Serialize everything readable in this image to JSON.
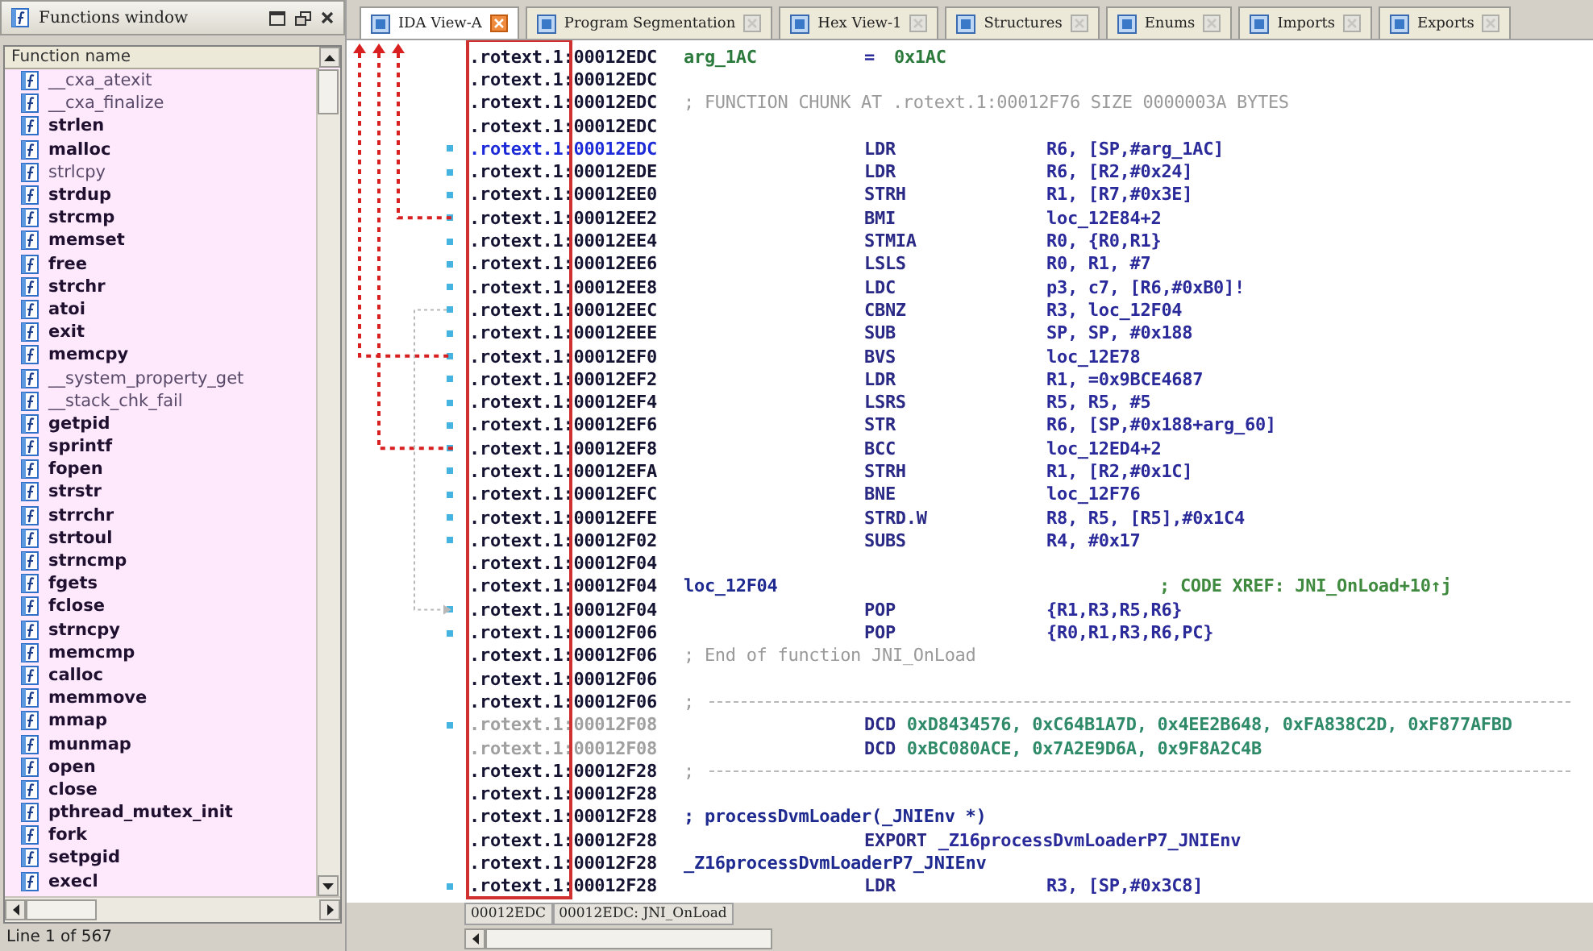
{
  "functions_window": {
    "title": "Functions window",
    "column": "Function name",
    "footer": "Line 1 of 567",
    "items": [
      {
        "name": "__cxa_atexit",
        "library": true
      },
      {
        "name": "__cxa_finalize",
        "library": true
      },
      {
        "name": "strlen",
        "library": false
      },
      {
        "name": "malloc",
        "library": false
      },
      {
        "name": "strlcpy",
        "library": true
      },
      {
        "name": "strdup",
        "library": false
      },
      {
        "name": "strcmp",
        "library": false
      },
      {
        "name": "memset",
        "library": false
      },
      {
        "name": "free",
        "library": false
      },
      {
        "name": "strchr",
        "library": false
      },
      {
        "name": "atoi",
        "library": false
      },
      {
        "name": "exit",
        "library": false
      },
      {
        "name": "memcpy",
        "library": false
      },
      {
        "name": "__system_property_get",
        "library": true
      },
      {
        "name": "__stack_chk_fail",
        "library": true
      },
      {
        "name": "getpid",
        "library": false
      },
      {
        "name": "sprintf",
        "library": false
      },
      {
        "name": "fopen",
        "library": false
      },
      {
        "name": "strstr",
        "library": false
      },
      {
        "name": "strrchr",
        "library": false
      },
      {
        "name": "strtoul",
        "library": false
      },
      {
        "name": "strncmp",
        "library": false
      },
      {
        "name": "fgets",
        "library": false
      },
      {
        "name": "fclose",
        "library": false
      },
      {
        "name": "strncpy",
        "library": false
      },
      {
        "name": "memcmp",
        "library": false
      },
      {
        "name": "calloc",
        "library": false
      },
      {
        "name": "memmove",
        "library": false
      },
      {
        "name": "mmap",
        "library": false
      },
      {
        "name": "munmap",
        "library": false
      },
      {
        "name": "open",
        "library": false
      },
      {
        "name": "close",
        "library": false
      },
      {
        "name": "pthread_mutex_init",
        "library": false
      },
      {
        "name": "fork",
        "library": false
      },
      {
        "name": "setpgid",
        "library": false
      },
      {
        "name": "execl",
        "library": false
      }
    ]
  },
  "tabs": [
    {
      "label": "IDA View-A",
      "selected": true
    },
    {
      "label": "Program Segmentation",
      "selected": false
    },
    {
      "label": "Hex View-1",
      "selected": false
    },
    {
      "label": "Structures",
      "selected": false
    },
    {
      "label": "Enums",
      "selected": false
    },
    {
      "label": "Imports",
      "selected": false
    },
    {
      "label": "Exports",
      "selected": false
    }
  ],
  "lines": [
    {
      "kind": "stackvar",
      "address": ".rotext.1:00012EDC",
      "name": "arg_1AC",
      "assign": "=",
      "value": "0x1AC",
      "dot": false,
      "selected": false
    },
    {
      "kind": "blank",
      "address": ".rotext.1:00012EDC",
      "dot": false,
      "selected": false
    },
    {
      "kind": "comment",
      "address": ".rotext.1:00012EDC",
      "text": "; FUNCTION CHUNK AT .rotext.1:00012F76 SIZE 0000003A BYTES",
      "dot": false,
      "selected": false
    },
    {
      "kind": "blank",
      "address": ".rotext.1:00012EDC",
      "dot": false,
      "selected": false
    },
    {
      "kind": "instr",
      "address": ".rotext.1:00012EDC",
      "mnemonic": "LDR",
      "operands": "R6, [SP,#arg_1AC]",
      "dot": true,
      "selected": true
    },
    {
      "kind": "instr",
      "address": ".rotext.1:00012EDE",
      "mnemonic": "LDR",
      "operands": "R6, [R2,#0x24]",
      "dot": true,
      "selected": false
    },
    {
      "kind": "instr",
      "address": ".rotext.1:00012EE0",
      "mnemonic": "STRH",
      "operands": "R1, [R7,#0x3E]",
      "dot": true,
      "selected": false
    },
    {
      "kind": "instr",
      "address": ".rotext.1:00012EE2",
      "mnemonic": "BMI",
      "operands": "loc_12E84+2",
      "dot": true,
      "selected": false
    },
    {
      "kind": "instr",
      "address": ".rotext.1:00012EE4",
      "mnemonic": "STMIA",
      "operands": "R0, {R0,R1}",
      "dot": true,
      "selected": false
    },
    {
      "kind": "instr",
      "address": ".rotext.1:00012EE6",
      "mnemonic": "LSLS",
      "operands": "R0, R1, #7",
      "dot": true,
      "selected": false
    },
    {
      "kind": "instr",
      "address": ".rotext.1:00012EE8",
      "mnemonic": "LDC",
      "operands": "p3, c7, [R6,#0xB0]!",
      "dot": true,
      "selected": false
    },
    {
      "kind": "instr",
      "address": ".rotext.1:00012EEC",
      "mnemonic": "CBNZ",
      "operands": "R3, loc_12F04",
      "dot": true,
      "selected": false
    },
    {
      "kind": "instr",
      "address": ".rotext.1:00012EEE",
      "mnemonic": "SUB",
      "operands": "SP, SP, #0x188",
      "dot": true,
      "selected": false
    },
    {
      "kind": "instr",
      "address": ".rotext.1:00012EF0",
      "mnemonic": "BVS",
      "operands": "loc_12E78",
      "dot": true,
      "selected": false
    },
    {
      "kind": "instr",
      "address": ".rotext.1:00012EF2",
      "mnemonic": "LDR",
      "operands": "R1, =0x9BCE4687",
      "dot": true,
      "selected": false
    },
    {
      "kind": "instr",
      "address": ".rotext.1:00012EF4",
      "mnemonic": "LSRS",
      "operands": "R5, R5, #5",
      "dot": true,
      "selected": false
    },
    {
      "kind": "instr",
      "address": ".rotext.1:00012EF6",
      "mnemonic": "STR",
      "operands": "R6, [SP,#0x188+arg_60]",
      "dot": true,
      "selected": false
    },
    {
      "kind": "instr",
      "address": ".rotext.1:00012EF8",
      "mnemonic": "BCC",
      "operands": "loc_12ED4+2",
      "dot": true,
      "selected": false
    },
    {
      "kind": "instr",
      "address": ".rotext.1:00012EFA",
      "mnemonic": "STRH",
      "operands": "R1, [R2,#0x1C]",
      "dot": true,
      "selected": false
    },
    {
      "kind": "instr",
      "address": ".rotext.1:00012EFC",
      "mnemonic": "BNE",
      "operands": "loc_12F76",
      "dot": true,
      "selected": false
    },
    {
      "kind": "instr",
      "address": ".rotext.1:00012EFE",
      "mnemonic": "STRD.W",
      "operands": "R8, R5, [R5],#0x1C4",
      "dot": true,
      "selected": false
    },
    {
      "kind": "instr",
      "address": ".rotext.1:00012F02",
      "mnemonic": "SUBS",
      "operands": "R4, #0x17",
      "dot": true,
      "selected": false
    },
    {
      "kind": "blank",
      "address": ".rotext.1:00012F04",
      "dot": false,
      "selected": false
    },
    {
      "kind": "label",
      "address": ".rotext.1:00012F04",
      "label": "loc_12F04",
      "comment": "; CODE XREF: JNI_OnLoad+10↑j",
      "dot": false,
      "selected": false
    },
    {
      "kind": "instr",
      "address": ".rotext.1:00012F04",
      "mnemonic": "POP",
      "operands": "{R1,R3,R5,R6}",
      "dot": true,
      "selected": false
    },
    {
      "kind": "instr",
      "address": ".rotext.1:00012F06",
      "mnemonic": "POP",
      "operands": "{R0,R1,R3,R6,PC}",
      "dot": true,
      "selected": false
    },
    {
      "kind": "comment",
      "address": ".rotext.1:00012F06",
      "text": "; End of function JNI_OnLoad",
      "dot": false,
      "selected": false
    },
    {
      "kind": "blank",
      "address": ".rotext.1:00012F06",
      "dot": false,
      "selected": false
    },
    {
      "kind": "separator",
      "address": ".rotext.1:00012F06",
      "text": ";",
      "dot": false,
      "selected": false
    },
    {
      "kind": "data",
      "address": ".rotext.1:00012F08",
      "mnemonic": "DCD",
      "operands": "0xD8434576, 0xC64B1A7D, 0x4EE2B648, 0xFA838C2D, 0xF877AFBD",
      "dot": true,
      "selected": false
    },
    {
      "kind": "data",
      "address": ".rotext.1:00012F08",
      "mnemonic": "DCD",
      "operands": "0xBC080ACE, 0x7A2E9D6A, 0x9F8A2C4B",
      "dot": false,
      "selected": false
    },
    {
      "kind": "separator",
      "address": ".rotext.1:00012F28",
      "text": ";",
      "dot": false,
      "selected": false
    },
    {
      "kind": "blank",
      "address": ".rotext.1:00012F28",
      "dot": false,
      "selected": false
    },
    {
      "kind": "demangled",
      "address": ".rotext.1:00012F28",
      "text": "; processDvmLoader(_JNIEnv *)",
      "dot": false,
      "selected": false
    },
    {
      "kind": "directive",
      "address": ".rotext.1:00012F28",
      "mnemonic": "EXPORT",
      "operands": "_Z16processDvmLoaderP7_JNIEnv",
      "dot": false,
      "selected": false
    },
    {
      "kind": "label",
      "address": ".rotext.1:00012F28",
      "label": "_Z16processDvmLoaderP7_JNIEnv",
      "dot": false,
      "selected": false
    },
    {
      "kind": "instr",
      "address": ".rotext.1:00012F28",
      "mnemonic": "LDR",
      "operands": "R3, [SP,#0x3C8]",
      "dot": true,
      "selected": false
    }
  ],
  "status_bar": {
    "offset": "00012EDC",
    "location": "00012EDC: JNI_OnLoad"
  }
}
